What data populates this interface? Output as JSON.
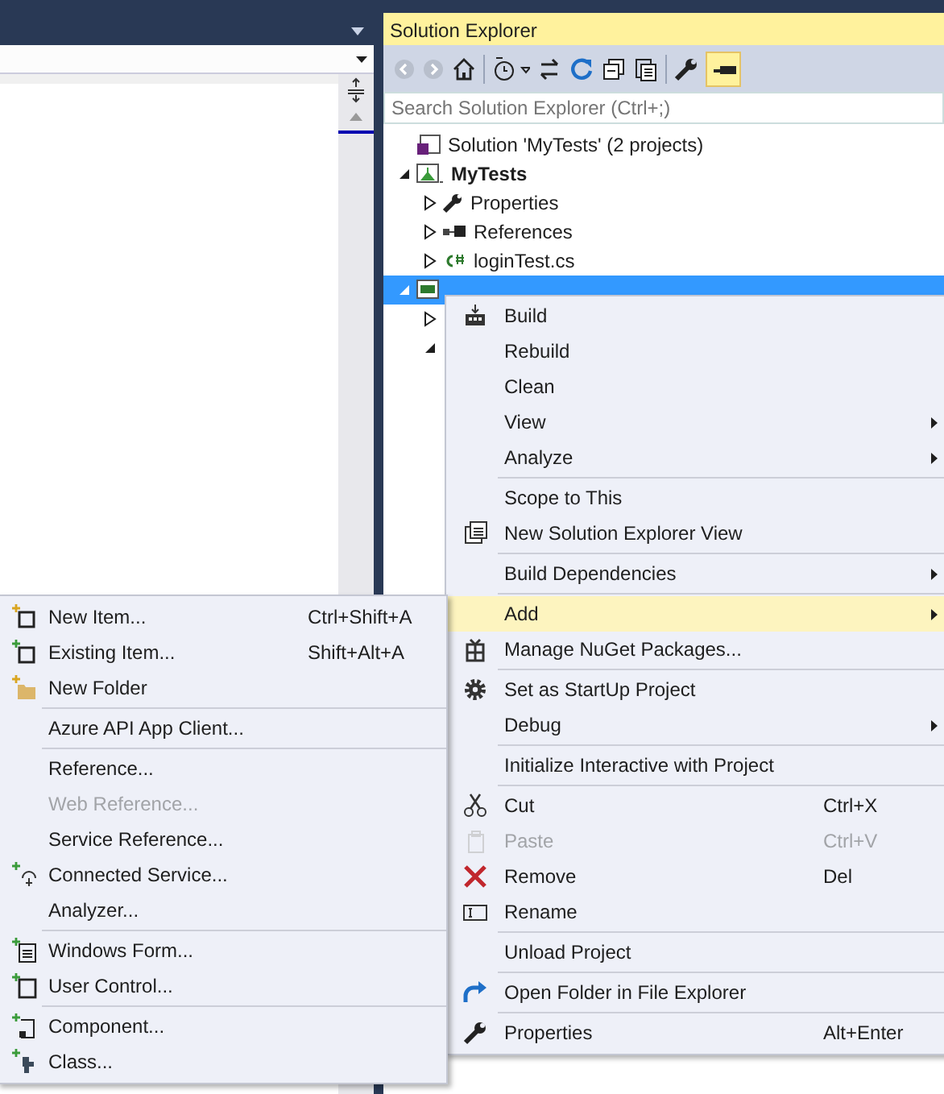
{
  "solution_explorer": {
    "title": "Solution Explorer",
    "search": {
      "placeholder": "Search Solution Explorer (Ctrl+;)"
    },
    "tree": [
      {
        "label": "Solution 'MyTests' (2 projects)",
        "selected": false,
        "children": [
          {
            "label": "MyTests",
            "bold": true,
            "expanded": true,
            "selected": false,
            "children": [
              {
                "label": "Properties",
                "expanded": false,
                "selected": false
              },
              {
                "label": "References",
                "expanded": false,
                "selected": false
              },
              {
                "label": "loginTest.cs",
                "expanded": false,
                "selected": false
              }
            ]
          },
          {
            "expanded": true,
            "selected": true,
            "children": [
              {
                "expanded": false
              },
              {
                "expanded": true
              }
            ]
          }
        ]
      }
    ]
  },
  "context_menu": {
    "groups": [
      [
        {
          "label": "Build",
          "disabled": false,
          "submenu": false,
          "highlighted": false
        },
        {
          "label": "Rebuild",
          "disabled": false,
          "submenu": false,
          "highlighted": false
        },
        {
          "label": "Clean",
          "disabled": false,
          "submenu": false,
          "highlighted": false
        },
        {
          "label": "View",
          "disabled": false,
          "submenu": true,
          "highlighted": false
        },
        {
          "label": "Analyze",
          "disabled": false,
          "submenu": true,
          "highlighted": false
        }
      ],
      [
        {
          "label": "Scope to This",
          "disabled": false,
          "submenu": false,
          "highlighted": false
        },
        {
          "label": "New Solution Explorer View",
          "disabled": false,
          "submenu": false,
          "highlighted": false
        }
      ],
      [
        {
          "label": "Build Dependencies",
          "disabled": false,
          "submenu": true,
          "highlighted": false
        }
      ],
      [
        {
          "label": "Add",
          "disabled": false,
          "submenu": true,
          "highlighted": true
        },
        {
          "label": "Manage NuGet Packages...",
          "disabled": false,
          "submenu": false,
          "highlighted": false
        }
      ],
      [
        {
          "label": "Set as StartUp Project",
          "disabled": false,
          "submenu": false,
          "highlighted": false
        },
        {
          "label": "Debug",
          "disabled": false,
          "submenu": true,
          "highlighted": false
        }
      ],
      [
        {
          "label": "Initialize Interactive with Project",
          "disabled": false,
          "submenu": false,
          "highlighted": false
        }
      ],
      [
        {
          "label": "Cut",
          "shortcut": "Ctrl+X",
          "disabled": false,
          "submenu": false,
          "highlighted": false
        },
        {
          "label": "Paste",
          "shortcut": "Ctrl+V",
          "disabled": true,
          "submenu": false,
          "highlighted": false
        },
        {
          "label": "Remove",
          "shortcut": "Del",
          "disabled": false,
          "submenu": false,
          "highlighted": false
        },
        {
          "label": "Rename",
          "disabled": false,
          "submenu": false,
          "highlighted": false
        }
      ],
      [
        {
          "label": "Unload Project",
          "disabled": false,
          "submenu": false,
          "highlighted": false
        }
      ],
      [
        {
          "label": "Open Folder in File Explorer",
          "disabled": false,
          "submenu": false,
          "highlighted": false
        }
      ],
      [
        {
          "label": "Properties",
          "shortcut": "Alt+Enter",
          "disabled": false,
          "submenu": false,
          "highlighted": false
        }
      ]
    ]
  },
  "add_submenu": {
    "groups": [
      [
        {
          "label": "New Item...",
          "shortcut": "Ctrl+Shift+A",
          "disabled": false
        },
        {
          "label": "Existing Item...",
          "shortcut": "Shift+Alt+A",
          "disabled": false
        },
        {
          "label": "New Folder",
          "disabled": false
        }
      ],
      [
        {
          "label": "Azure API App Client...",
          "disabled": false
        }
      ],
      [
        {
          "label": "Reference...",
          "disabled": false
        },
        {
          "label": "Web Reference...",
          "disabled": true
        },
        {
          "label": "Service Reference...",
          "disabled": false
        },
        {
          "label": "Connected Service...",
          "disabled": false
        },
        {
          "label": "Analyzer...",
          "disabled": false
        }
      ],
      [
        {
          "label": "Windows Form...",
          "disabled": false
        },
        {
          "label": "User Control...",
          "disabled": false
        }
      ],
      [
        {
          "label": "Component...",
          "disabled": false
        },
        {
          "label": "Class...",
          "disabled": false
        }
      ]
    ]
  }
}
